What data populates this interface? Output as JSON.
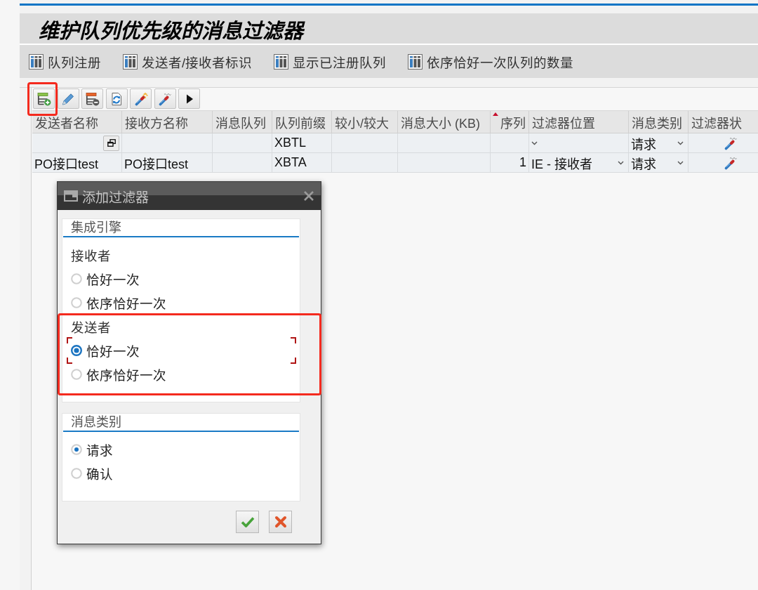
{
  "page_title": "维护队列优先级的消息过滤器",
  "application_toolbar": [
    {
      "label": "队列注册"
    },
    {
      "label": "发送者/接收者标识"
    },
    {
      "label": "显示已注册队列"
    },
    {
      "label": "依序恰好一次队列的数量"
    }
  ],
  "toolbar": [
    {
      "kind": "add_row",
      "highlighted": true
    },
    {
      "kind": "edit",
      "highlighted": false
    },
    {
      "kind": "delete_row",
      "highlighted": false
    },
    {
      "kind": "refresh",
      "highlighted": false
    },
    {
      "kind": "activate",
      "highlighted": false
    },
    {
      "kind": "deactivate",
      "highlighted": false
    },
    {
      "kind": "more",
      "highlighted": false
    }
  ],
  "table": {
    "columns": [
      {
        "label": "发送者名称",
        "kind": "text",
        "sorted": false
      },
      {
        "label": "接收方名称",
        "kind": "text",
        "sorted": false
      },
      {
        "label": "消息队列",
        "kind": "text",
        "sorted": false
      },
      {
        "label": "队列前缀",
        "kind": "text",
        "sorted": false
      },
      {
        "label": "较小/较大",
        "kind": "text",
        "sorted": false
      },
      {
        "label": "消息大小 (KB)",
        "kind": "text",
        "sorted": false
      },
      {
        "label": "序列",
        "kind": "number",
        "sorted": true
      },
      {
        "label": "过滤器位置",
        "kind": "dropdown",
        "sorted": false
      },
      {
        "label": "消息类别",
        "kind": "dropdown",
        "sorted": false
      },
      {
        "label": "过滤器状",
        "kind": "status",
        "sorted": false
      }
    ],
    "rows": [
      {
        "value_help": true,
        "queue_prefix": "XBTL",
        "message_category": "请求"
      },
      {
        "value_help": false,
        "sender_name": "PO接口test",
        "receiver_name": "PO接口test",
        "queue_prefix": "XBTA",
        "sequence": "1",
        "filter_position": "IE - 接收者",
        "message_category": "请求"
      }
    ]
  },
  "dialog": {
    "title": "添加过滤器",
    "groups": [
      {
        "title": "集成引擎",
        "sections": [
          {
            "label": "接收者",
            "highlighted": false,
            "options": [
              {
                "label": "恰好一次",
                "selected": false,
                "focused": false
              },
              {
                "label": "依序恰好一次",
                "selected": false,
                "focused": false
              }
            ]
          },
          {
            "label": "发送者",
            "highlighted": true,
            "options": [
              {
                "label": "恰好一次",
                "selected": true,
                "focused": true
              },
              {
                "label": "依序恰好一次",
                "selected": false,
                "focused": false
              }
            ]
          }
        ]
      },
      {
        "title": "消息类别",
        "sections": [
          {
            "highlighted": false,
            "options": [
              {
                "label": "请求",
                "selected": true,
                "focused": false
              },
              {
                "label": "确认",
                "selected": false,
                "focused": false
              }
            ]
          }
        ]
      }
    ],
    "buttons": [
      {
        "kind": "confirm"
      },
      {
        "kind": "cancel"
      }
    ]
  }
}
